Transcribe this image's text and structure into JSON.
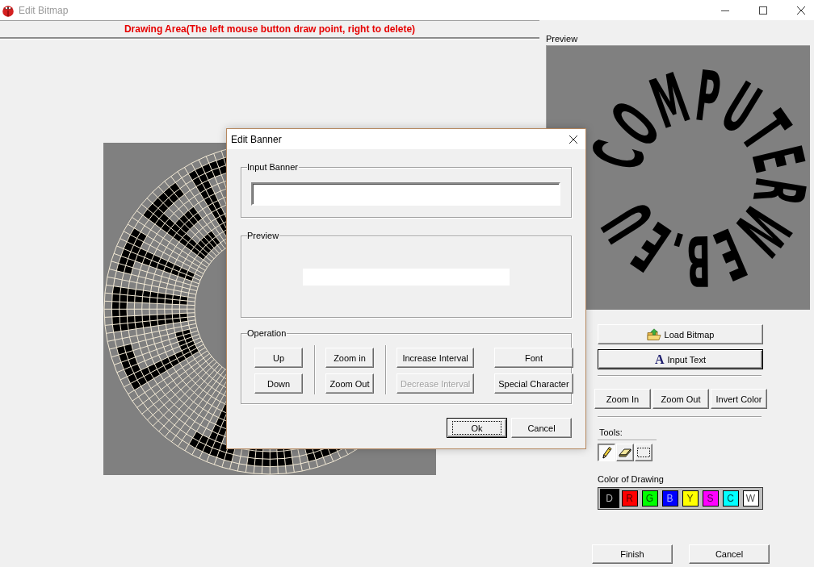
{
  "window": {
    "title": "Edit Bitmap"
  },
  "drawing_area": {
    "header": "Drawing Area(The left mouse button draw point, right to delete)"
  },
  "preview": {
    "label": "Preview",
    "text": "COMPUTERWEB.EU"
  },
  "actions": [
    {
      "label": "Load Bitmap",
      "kind": "load",
      "default": false
    },
    {
      "label": "Input Text",
      "kind": "text",
      "glyph": "A",
      "default": true
    }
  ],
  "view_buttons": [
    "Zoom In",
    "Zoom Out",
    "Invert Color"
  ],
  "tools": {
    "label": "Tools:",
    "items": [
      {
        "kind": "pencil",
        "selected": true
      },
      {
        "kind": "eraser",
        "selected": false
      },
      {
        "kind": "select",
        "selected": false
      }
    ]
  },
  "drawing_colors": {
    "label": "Color of Drawing",
    "items": [
      {
        "letter": "D",
        "color": "#000000",
        "selected": true
      },
      {
        "letter": "R",
        "color": "#ff0000",
        "selected": false
      },
      {
        "letter": "G",
        "color": "#00ff00",
        "selected": false
      },
      {
        "letter": "B",
        "color": "#0000ff",
        "selected": false
      },
      {
        "letter": "Y",
        "color": "#ffff00",
        "selected": false
      },
      {
        "letter": "S",
        "color": "#ff00ff",
        "selected": false
      },
      {
        "letter": "C",
        "color": "#00ffff",
        "selected": false
      },
      {
        "letter": "W",
        "color": "#ffffff",
        "selected": false
      }
    ]
  },
  "footer_buttons": [
    "Finish",
    "Cancel"
  ],
  "dialog": {
    "title": "Edit Banner",
    "input_group": {
      "label": "Input Banner"
    },
    "preview_group": {
      "label": "Preview"
    },
    "operation": {
      "label": "Operation",
      "sections": [
        {
          "columns": [
            {
              "buttons": [
                {
                  "label": "Up",
                  "disabled": false
                },
                {
                  "label": "Down",
                  "disabled": false
                }
              ]
            }
          ]
        },
        {
          "columns": [
            {
              "buttons": [
                {
                  "label": "Zoom in",
                  "disabled": false
                },
                {
                  "label": "Zoom Out",
                  "disabled": false
                }
              ]
            }
          ]
        },
        {
          "columns": [
            {
              "buttons": [
                {
                  "label": "Increase Interval",
                  "disabled": false
                },
                {
                  "label": "Decrease Interval",
                  "disabled": true
                }
              ]
            },
            {
              "buttons": [
                {
                  "label": "Font",
                  "disabled": false
                },
                {
                  "label": "Special Character",
                  "disabled": false
                }
              ]
            }
          ]
        }
      ]
    },
    "buttons": [
      {
        "label": "Ok",
        "default": true
      },
      {
        "label": "Cancel",
        "default": false
      }
    ]
  }
}
